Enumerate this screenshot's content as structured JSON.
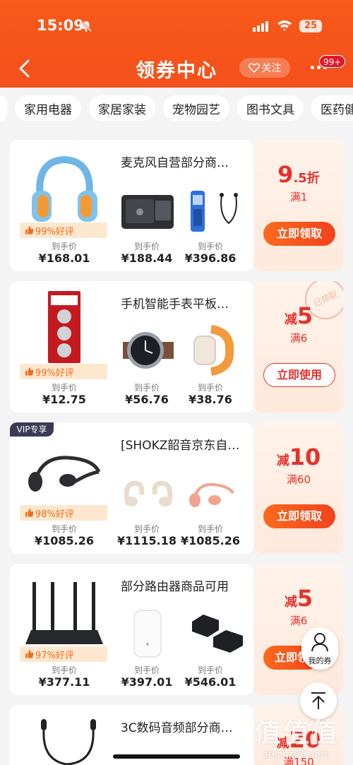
{
  "status_bar": {
    "time": "15:09",
    "battery": "25"
  },
  "header": {
    "title": "领券中心",
    "follow_label": "关注",
    "notification_badge": "99+"
  },
  "tabs": [
    "家用电器",
    "家居家装",
    "宠物园艺",
    "图书文具",
    "医药健"
  ],
  "price_label": "到手价",
  "cards": [
    {
      "title": "麦克风自营部分商…",
      "rating": "99%好评",
      "prices": [
        "¥168.01",
        "¥188.44",
        "¥396.86"
      ],
      "coupon": {
        "value": "9",
        "value_suffix": ".5折",
        "condition": "满1",
        "button": "立即领取"
      }
    },
    {
      "title": "手机智能手表平板…",
      "rating": "99%好评",
      "prices": [
        "¥12.75",
        "¥56.76",
        "¥38.76"
      ],
      "coupon": {
        "value_prefix": "减",
        "value": "5",
        "condition": "满6",
        "button": "立即使用",
        "stamp": "已领取"
      }
    },
    {
      "vip_tag": "VIP专享",
      "title": "[SHOKZ韶音京东自…",
      "rating": "98%好评",
      "prices": [
        "¥1085.26",
        "¥1115.18",
        "¥1085.26"
      ],
      "coupon": {
        "value_prefix": "减",
        "value": "10",
        "condition": "满60",
        "button": "立即领取"
      }
    },
    {
      "title": "部分路由器商品可用",
      "rating": "97%好评",
      "prices": [
        "¥377.11",
        "¥397.01",
        "¥546.01"
      ],
      "coupon": {
        "value_prefix": "减",
        "value": "5",
        "condition": "满6",
        "button": "立即领"
      }
    },
    {
      "title": "3C数码音频部分商…",
      "coupon": {
        "value_prefix": "减",
        "value": "20",
        "condition": "满150"
      }
    }
  ],
  "floating": {
    "my_coupons": "我的券"
  },
  "watermark": {
    "logo": "值值值",
    "url": "zhizhizhi.com"
  },
  "colors": {
    "brand_orange": "#f4501b",
    "coupon_red": "#e5322d",
    "rating_bg": "#fde8cf"
  }
}
